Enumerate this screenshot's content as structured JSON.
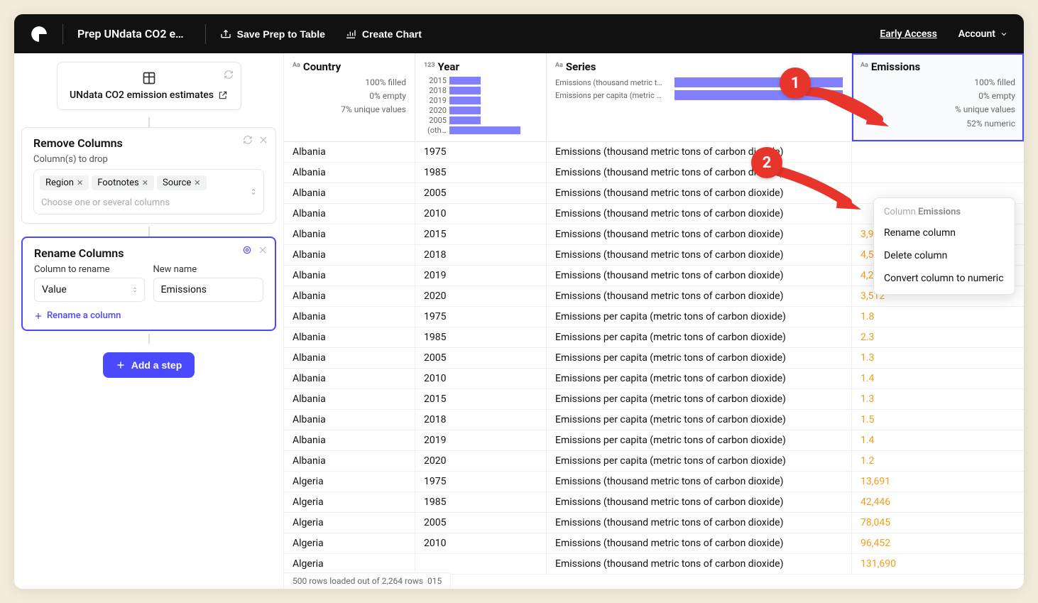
{
  "topbar": {
    "title": "Prep UNdata CO2 e…",
    "save_label": "Save Prep to Table",
    "chart_label": "Create Chart",
    "early_access": "Early Access",
    "account": "Account"
  },
  "source": {
    "name": "UNdata CO2 emission estimates"
  },
  "steps": {
    "remove": {
      "title": "Remove Columns",
      "sub": "Column(s) to drop",
      "chips": [
        "Region",
        "Footnotes",
        "Source"
      ],
      "placeholder": "Choose one or several columns"
    },
    "rename": {
      "title": "Rename Columns",
      "col_label": "Column to rename",
      "new_label": "New name",
      "col_value": "Value",
      "new_value": "Emissions",
      "add_link": "Rename a column"
    },
    "add_step": "Add a step"
  },
  "columns": {
    "country": {
      "name": "Country",
      "type": "Aa",
      "stats": [
        "100% filled",
        "0% empty",
        "7% unique values"
      ]
    },
    "year": {
      "name": "Year",
      "type": "123",
      "bars": [
        {
          "label": "2015",
          "pct": 44
        },
        {
          "label": "2018",
          "pct": 44
        },
        {
          "label": "2019",
          "pct": 44
        },
        {
          "label": "2020",
          "pct": 44
        },
        {
          "label": "2005",
          "pct": 44
        },
        {
          "label": "(oth…",
          "pct": 100
        }
      ]
    },
    "series": {
      "name": "Series",
      "type": "Aa",
      "bars": [
        {
          "label": "Emissions (thousand metric t…",
          "pct": 100
        },
        {
          "label": "Emissions per capita (metric …",
          "pct": 100
        }
      ]
    },
    "emissions": {
      "name": "Emissions",
      "type": "Aa",
      "stats": [
        "100% filled",
        "0% empty",
        "% unique values",
        "52% numeric"
      ]
    }
  },
  "context_menu": {
    "title_prefix": "Column",
    "title_col": "Emissions",
    "rename": "Rename column",
    "delete": "Delete column",
    "convert": "Convert column to numeric"
  },
  "callouts": {
    "one": "1",
    "two": "2"
  },
  "rows": [
    {
      "country": "Albania",
      "year": "1975",
      "series": "Emissions (thousand metric tons of carbon dioxide)",
      "emissions": ""
    },
    {
      "country": "Albania",
      "year": "1985",
      "series": "Emissions (thousand metric tons of carbon dioxide)",
      "emissions": ""
    },
    {
      "country": "Albania",
      "year": "2005",
      "series": "Emissions (thousand metric tons of carbon dioxide)",
      "emissions": ""
    },
    {
      "country": "Albania",
      "year": "2010",
      "series": "Emissions (thousand metric tons of carbon dioxide)",
      "emissions": ""
    },
    {
      "country": "Albania",
      "year": "2015",
      "series": "Emissions (thousand metric tons of carbon dioxide)",
      "emissions": "3,975"
    },
    {
      "country": "Albania",
      "year": "2018",
      "series": "Emissions (thousand metric tons of carbon dioxide)",
      "emissions": "4,525"
    },
    {
      "country": "Albania",
      "year": "2019",
      "series": "Emissions (thousand metric tons of carbon dioxide)",
      "emissions": "4,200"
    },
    {
      "country": "Albania",
      "year": "2020",
      "series": "Emissions (thousand metric tons of carbon dioxide)",
      "emissions": "3,512"
    },
    {
      "country": "Albania",
      "year": "1975",
      "series": "Emissions per capita (metric tons of carbon dioxide)",
      "emissions": "1.8"
    },
    {
      "country": "Albania",
      "year": "1985",
      "series": "Emissions per capita (metric tons of carbon dioxide)",
      "emissions": "2.3"
    },
    {
      "country": "Albania",
      "year": "2005",
      "series": "Emissions per capita (metric tons of carbon dioxide)",
      "emissions": "1.3"
    },
    {
      "country": "Albania",
      "year": "2010",
      "series": "Emissions per capita (metric tons of carbon dioxide)",
      "emissions": "1.4"
    },
    {
      "country": "Albania",
      "year": "2015",
      "series": "Emissions per capita (metric tons of carbon dioxide)",
      "emissions": "1.3"
    },
    {
      "country": "Albania",
      "year": "2018",
      "series": "Emissions per capita (metric tons of carbon dioxide)",
      "emissions": "1.5"
    },
    {
      "country": "Albania",
      "year": "2019",
      "series": "Emissions per capita (metric tons of carbon dioxide)",
      "emissions": "1.4"
    },
    {
      "country": "Albania",
      "year": "2020",
      "series": "Emissions per capita (metric tons of carbon dioxide)",
      "emissions": "1.2"
    },
    {
      "country": "Algeria",
      "year": "1975",
      "series": "Emissions (thousand metric tons of carbon dioxide)",
      "emissions": "13,691"
    },
    {
      "country": "Algeria",
      "year": "1985",
      "series": "Emissions (thousand metric tons of carbon dioxide)",
      "emissions": "42,446"
    },
    {
      "country": "Algeria",
      "year": "2005",
      "series": "Emissions (thousand metric tons of carbon dioxide)",
      "emissions": "78,045"
    },
    {
      "country": "Algeria",
      "year": "2010",
      "series": "Emissions (thousand metric tons of carbon dioxide)",
      "emissions": "96,452"
    },
    {
      "country": "Algeria",
      "year": "",
      "series": "Emissions (thousand metric tons of carbon dioxide)",
      "emissions": "131,690"
    }
  ],
  "footer": {
    "text": "500 rows loaded out of 2,264 rows",
    "trailing": "015"
  }
}
